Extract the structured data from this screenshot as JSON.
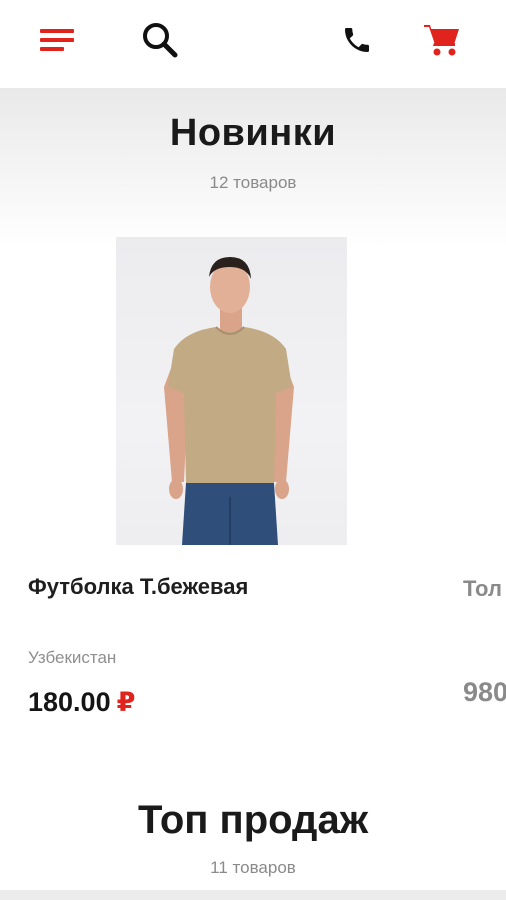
{
  "header": {
    "menu_icon": "hamburger-menu-icon",
    "search_icon": "search-icon",
    "phone_icon": "phone-icon",
    "cart_icon": "shopping-cart-icon",
    "accent_color": "#e0231d"
  },
  "new_arrivals": {
    "title": "Новинки",
    "count": "12 товаров",
    "products": [
      {
        "name": "Футболка Т.бежевая",
        "origin": "Узбекистан",
        "price": "180.00",
        "currency": "₽"
      },
      {
        "name": "Тол",
        "price": "980"
      }
    ]
  },
  "bestsellers": {
    "title": "Топ продаж",
    "count": "11 товаров"
  }
}
